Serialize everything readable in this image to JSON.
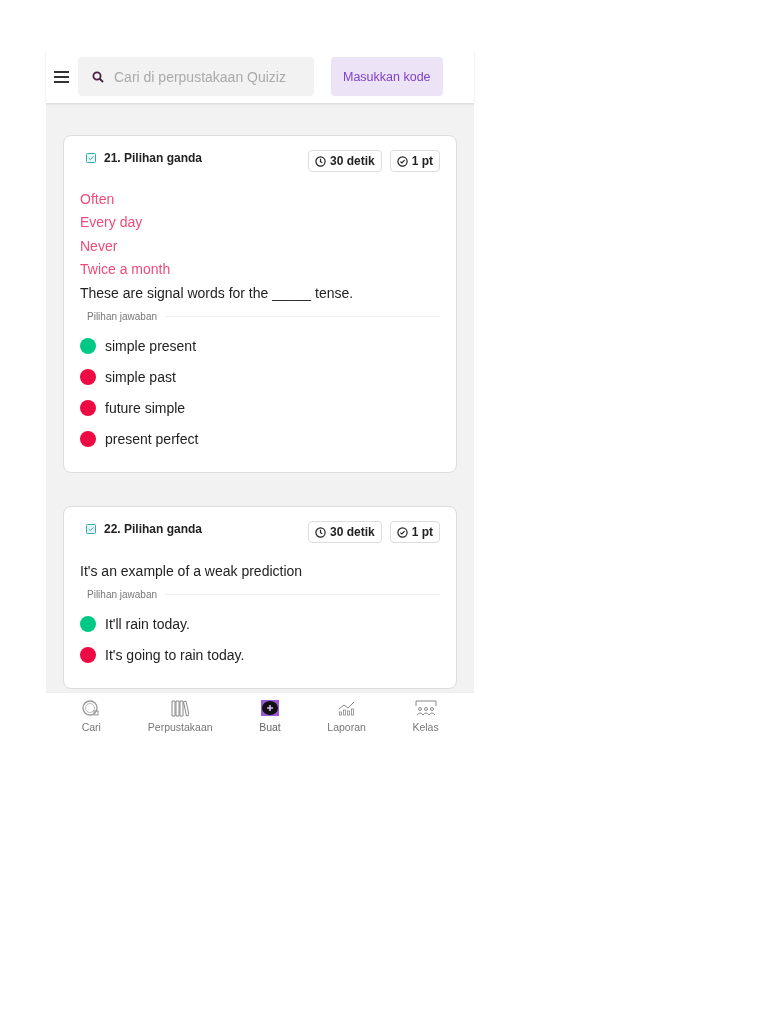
{
  "header": {
    "search": {
      "placeholder": "Cari di perpustakaan Quiziz"
    },
    "join_button": "Masukkan kode"
  },
  "questions": [
    {
      "title": "21. Pilihan ganda",
      "time": "30 detik",
      "points": "1 pt",
      "signal_words": [
        "Often",
        "Every day",
        "Never",
        "Twice a month"
      ],
      "question": "These are signal words for the _____ tense.",
      "answers_label": "Pilihan jawaban",
      "answers": [
        {
          "text": "simple present",
          "correct": true
        },
        {
          "text": "simple past",
          "correct": false
        },
        {
          "text": "future simple",
          "correct": false
        },
        {
          "text": "present perfect",
          "correct": false
        }
      ]
    },
    {
      "title": "22. Pilihan ganda",
      "time": "30 detik",
      "points": "1 pt",
      "question": "It's an example of a weak prediction",
      "answers_label": "Pilihan jawaban",
      "answers": [
        {
          "text": "It'll rain today.",
          "correct": true
        },
        {
          "text": "It's going to rain today.",
          "correct": false
        }
      ]
    }
  ],
  "nav": [
    {
      "kind": "search",
      "label": "Cari",
      "selected": false
    },
    {
      "kind": "library",
      "label": "Perpustakaan",
      "selected": false
    },
    {
      "kind": "create",
      "label": "Buat",
      "selected": true
    },
    {
      "kind": "reports",
      "label": "Laporan",
      "selected": false
    },
    {
      "kind": "classes",
      "label": "Kelas",
      "selected": false
    }
  ]
}
